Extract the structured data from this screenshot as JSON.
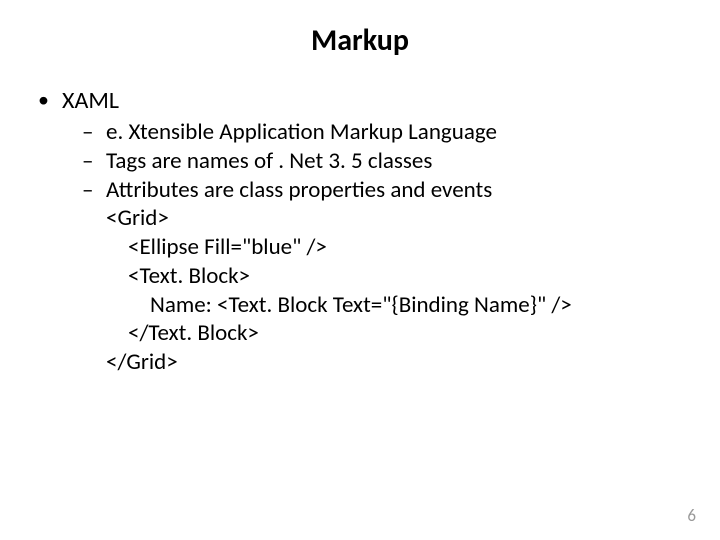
{
  "title": "Markup",
  "bullet1": "XAML",
  "sub1": "e. Xtensible Application Markup Language",
  "sub2": "Tags are names of . Net 3. 5 classes",
  "sub3": "Attributes are class properties and events",
  "code": {
    "l1": "<Grid>",
    "l2": "<Ellipse Fill=\"blue\" />",
    "l3": "<Text. Block>",
    "l4": "Name: <Text. Block Text=\"{Binding Name}\" />",
    "l5": "</Text. Block>",
    "l6": "</Grid>"
  },
  "pageNumber": "6"
}
